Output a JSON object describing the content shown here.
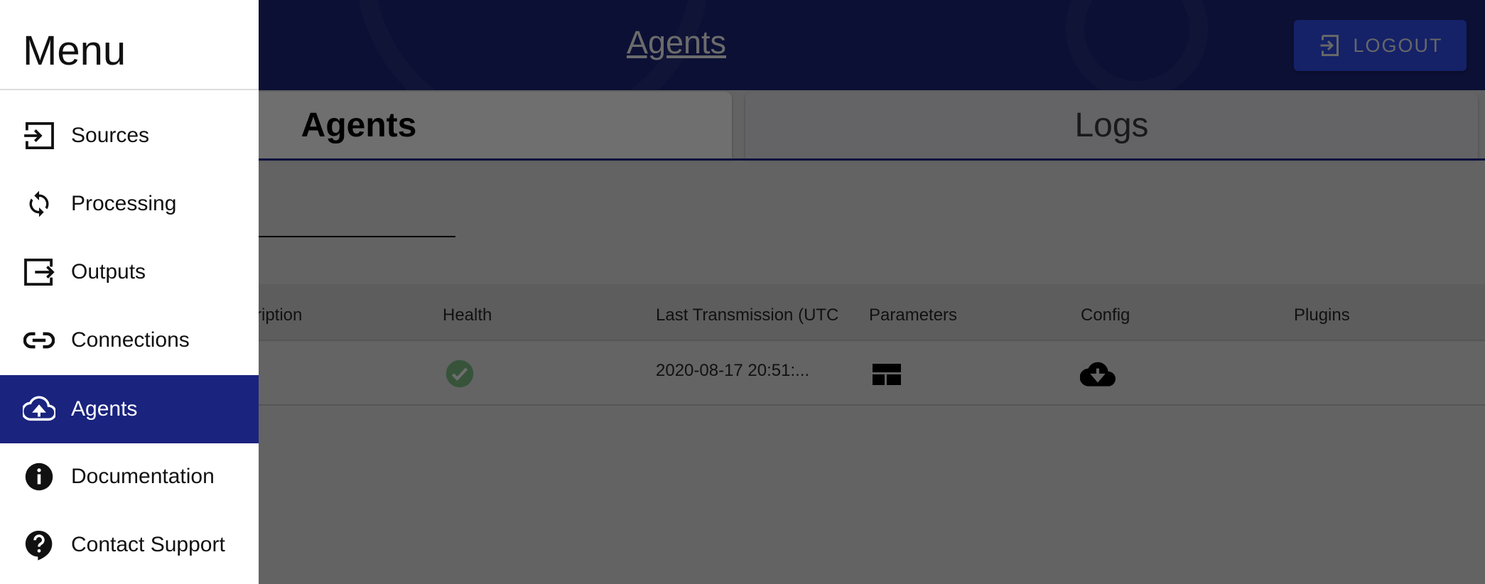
{
  "header": {
    "title": "Agents",
    "logout_label": "LOGOUT"
  },
  "tabs": [
    {
      "label": "Agents",
      "active": true
    },
    {
      "label": "Logs",
      "active": false
    }
  ],
  "table": {
    "columns": [
      "scription",
      "Health",
      "Last Transmission (UTC",
      "Parameters",
      "Config",
      "Plugins"
    ],
    "rows": [
      {
        "health": "healthy-check-icon",
        "last_transmission": "2020-08-17 20:51:...",
        "parameters": "table-icon",
        "config": "cloud-download-icon",
        "plugins": ""
      }
    ]
  },
  "drawer": {
    "title": "Menu",
    "items": [
      {
        "label": "Sources",
        "icon": "input-icon"
      },
      {
        "label": "Processing",
        "icon": "sync-icon"
      },
      {
        "label": "Outputs",
        "icon": "output-icon"
      },
      {
        "label": "Connections",
        "icon": "link-icon"
      },
      {
        "label": "Agents",
        "icon": "cloud-upload-icon",
        "active": true
      },
      {
        "label": "Documentation",
        "icon": "info-icon"
      },
      {
        "label": "Contact Support",
        "icon": "help-icon"
      }
    ]
  },
  "colors": {
    "primary": "#1a237e",
    "health_ok": "#4caf50"
  }
}
